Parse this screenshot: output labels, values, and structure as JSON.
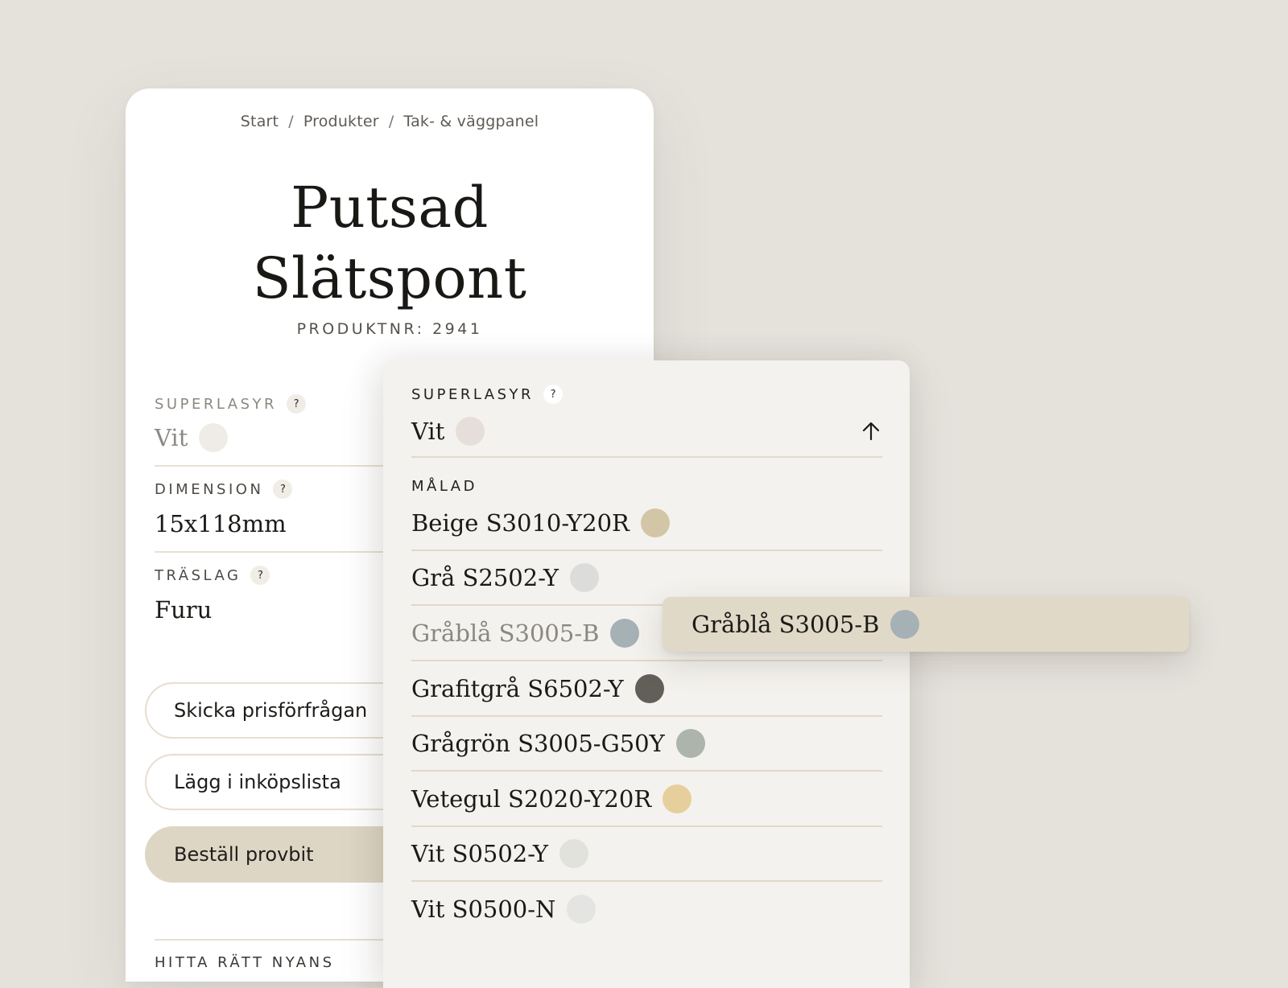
{
  "breadcrumb": {
    "items": [
      "Start",
      "Produkter",
      "Tak- & väggpanel"
    ],
    "separator": "/"
  },
  "product": {
    "title_line1": "Putsad",
    "title_line2": "Slätspont",
    "product_number": "PRODUKTNR: 2941"
  },
  "fields": {
    "superlasyr": {
      "label": "SUPERLASYR",
      "help": "?",
      "value": "Vit",
      "swatch_color": "#efebe6"
    },
    "dimension": {
      "label": "DIMENSION",
      "help": "?",
      "value": "15x118mm"
    },
    "traslag": {
      "label": "TRÄSLAG",
      "help": "?",
      "value": "Furu"
    }
  },
  "actions": {
    "price_request": "Skicka prisförfrågan",
    "add_to_list": "Lägg i inköpslista",
    "order_sample": "Beställ provbit"
  },
  "bottom_section_label": "HITTA RÄTT NYANS",
  "dropdown": {
    "label": "SUPERLASYR",
    "help": "?",
    "selected": {
      "name": "Vit",
      "color": "#e6dfd9"
    },
    "arrow_icon": "arrow-up-icon",
    "group_label": "MÅLAD",
    "options": [
      {
        "name": "Beige S3010-Y20R",
        "color": "#d3c6a7",
        "state": "normal"
      },
      {
        "name": "Grå S2502-Y",
        "color": "#dcdcda",
        "state": "normal"
      },
      {
        "name": "Gråblå S3005-B",
        "color": "#a6b1b6",
        "state": "hovered"
      },
      {
        "name": "Grafitgrå S6502-Y",
        "color": "#625e58",
        "state": "normal"
      },
      {
        "name": "Grågrön S3005-G50Y",
        "color": "#adb4ac",
        "state": "normal"
      },
      {
        "name": "Vetegul S2020-Y20R",
        "color": "#e6cf9c",
        "state": "normal"
      },
      {
        "name": "Vit S0502-Y",
        "color": "#e1e2dc",
        "state": "normal"
      },
      {
        "name": "Vit S0500-N",
        "color": "#e4e4e2",
        "state": "normal"
      }
    ]
  },
  "hover_chip": {
    "name": "Gråblå S3005-B",
    "color": "#a6b1b6"
  }
}
